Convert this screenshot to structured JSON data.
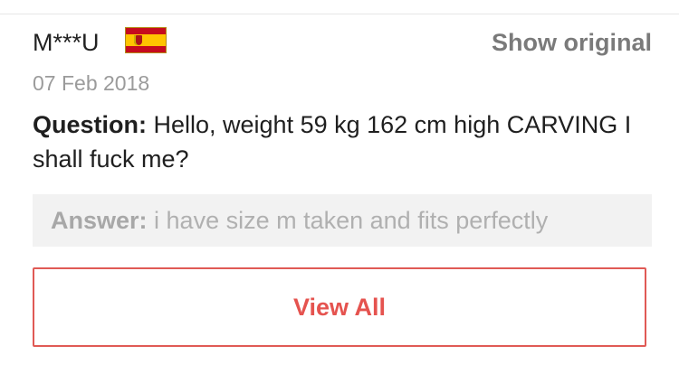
{
  "review": {
    "user_name": "M***U",
    "country_flag": "spain-flag",
    "show_original_label": "Show original",
    "date": "07 Feb 2018",
    "question_label": "Question:",
    "question_text": " Hello, weight 59 kg 162 cm high CARVING I shall fuck me?",
    "answer_label": "Answer:",
    "answer_text": " i have size m taken and fits perfectly"
  },
  "actions": {
    "view_all_label": "View All"
  },
  "colors": {
    "accent": "#e5534f",
    "muted_text": "#9b9b9b",
    "answer_background": "#f2f2f2"
  }
}
